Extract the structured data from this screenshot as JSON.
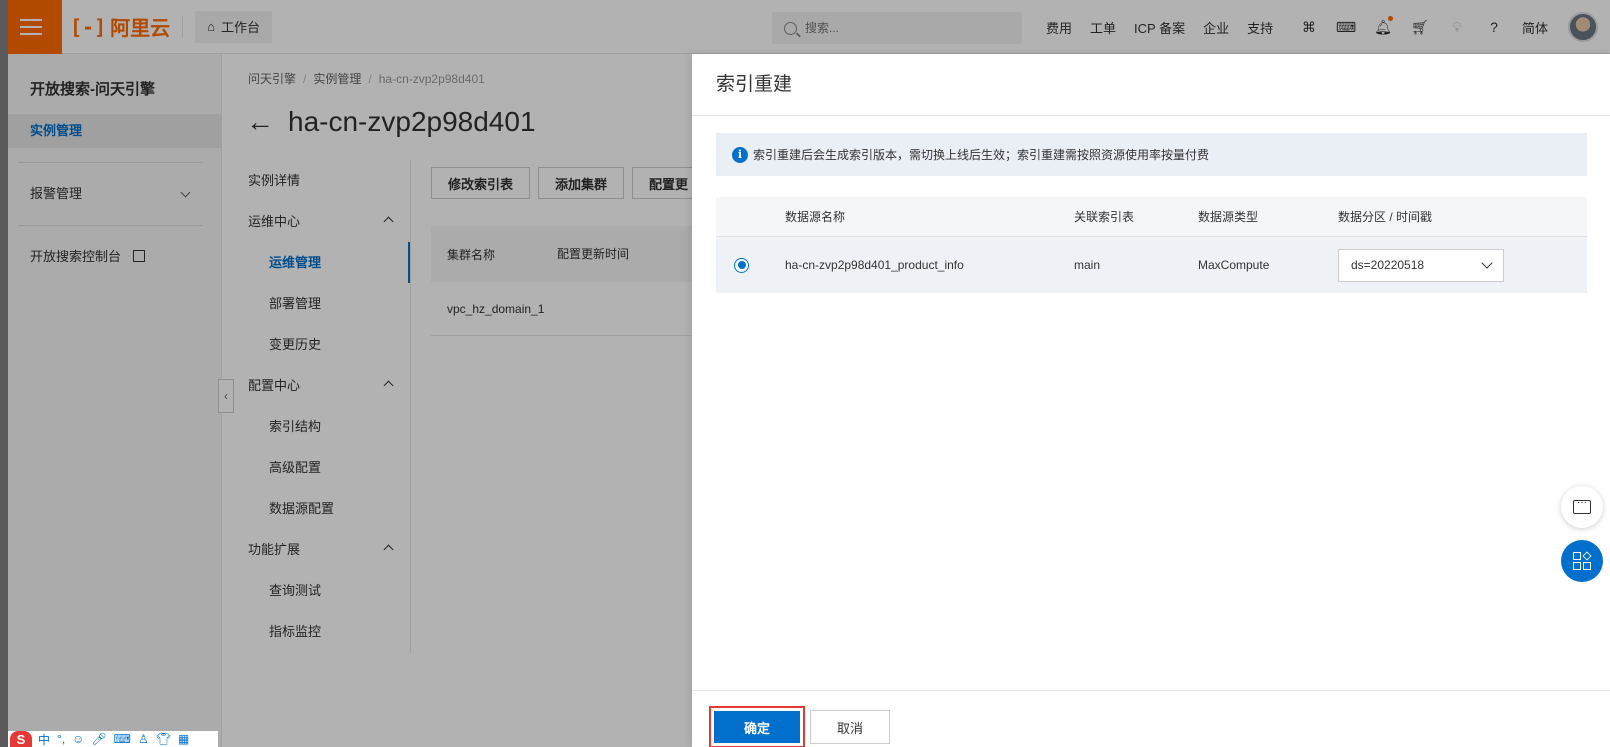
{
  "topbar": {
    "logo_text": "阿里云",
    "workbench_label": "工作台",
    "search_placeholder": "搜索...",
    "links": [
      "费用",
      "工单",
      "ICP 备案",
      "企业",
      "支持"
    ],
    "language": "简体",
    "accent_color": "#ff6a00"
  },
  "sidebar": {
    "title": "开放搜索-问天引擎",
    "items": [
      {
        "label": "实例管理",
        "active": true
      },
      {
        "label": "报警管理",
        "active": false
      },
      {
        "label": "开放搜索控制台",
        "active": false
      }
    ]
  },
  "main": {
    "breadcrumb": [
      "问天引擎",
      "实例管理",
      "ha-cn-zvp2p98d401"
    ],
    "title": "ha-cn-zvp2p98d401",
    "subnav": [
      {
        "label": "实例详情"
      },
      {
        "label": "运维中心"
      },
      {
        "label": "运维管理"
      },
      {
        "label": "部署管理"
      },
      {
        "label": "变更历史"
      },
      {
        "label": "配置中心"
      },
      {
        "label": "索引结构"
      },
      {
        "label": "高级配置"
      },
      {
        "label": "数据源配置"
      },
      {
        "label": "功能扩展"
      },
      {
        "label": "查询测试"
      },
      {
        "label": "指标监控"
      }
    ],
    "buttons": [
      "修改索引表",
      "添加集群",
      "配置更"
    ],
    "cluster_table": {
      "headers": [
        "集群名称",
        "配置更新时间"
      ],
      "rows": [
        [
          "vpc_hz_domain_1"
        ]
      ]
    }
  },
  "drawer": {
    "title": "索引重建",
    "notice": "索引重建后会生成索引版本，需切换上线后生效；索引重建需按照资源使用率按量付费",
    "table": {
      "headers": [
        "数据源名称",
        "关联索引表",
        "数据源类型",
        "数据分区 / 时间戳"
      ],
      "rows": [
        {
          "name": "ha-cn-zvp2p98d401_product_info",
          "index_table": "main",
          "type": "MaxCompute",
          "partition": "ds=20220518",
          "selected": true
        }
      ]
    },
    "confirm_label": "确定",
    "cancel_label": "取消",
    "primary_color": "#0070cc"
  },
  "ime": {
    "logo": "S",
    "mode": "中"
  }
}
